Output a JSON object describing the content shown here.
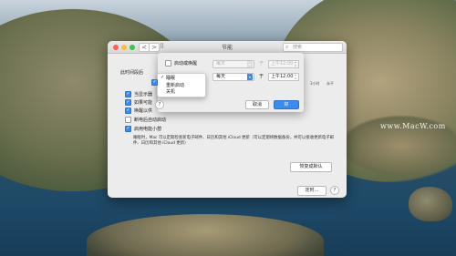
{
  "window": {
    "title": "节能",
    "search_placeholder": "搜索",
    "nav_back": "<",
    "nav_forward": ">",
    "grid_glyph": "⠿"
  },
  "background": {
    "partial_label": "此时间段后",
    "checkboxes": [
      {
        "label": "当显示器",
        "checked": true
      },
      {
        "label": "如果可能",
        "checked": true
      },
      {
        "label": "唤醒以供",
        "checked": true
      },
      {
        "label": "断电后自动启动",
        "checked": false
      },
      {
        "label": "启用电能小憩",
        "checked": true
      }
    ],
    "powernap_desc": "睡眠时，Mac 可以定期检查新电子邮件、日历和其他 iCloud 更新（可以定期将数据备份，并可以接收更新电子邮件、日历和其他 iCloud 更新）",
    "slider_end_labels": [
      "3小时",
      "永不"
    ],
    "restore_button": "恢复成默认",
    "schedule_button": "定时...",
    "help": "?"
  },
  "sheet": {
    "row1": {
      "label": "启动或唤醒",
      "checked": false,
      "day": "每天",
      "at": "于",
      "time": "上午12:00"
    },
    "row2": {
      "checked": true,
      "action": "睡眠",
      "day": "每天",
      "at": "于",
      "time": "上午12:00"
    },
    "help": "?",
    "cancel": "取消",
    "ok": "好"
  },
  "menu": {
    "items": [
      {
        "label": "睡眠",
        "selected": true
      },
      {
        "label": "重新启动",
        "selected": false
      },
      {
        "label": "关机",
        "selected": false
      }
    ]
  },
  "watermark": "www.MacW.com",
  "colors": {
    "accent": "#3a8bf0"
  }
}
